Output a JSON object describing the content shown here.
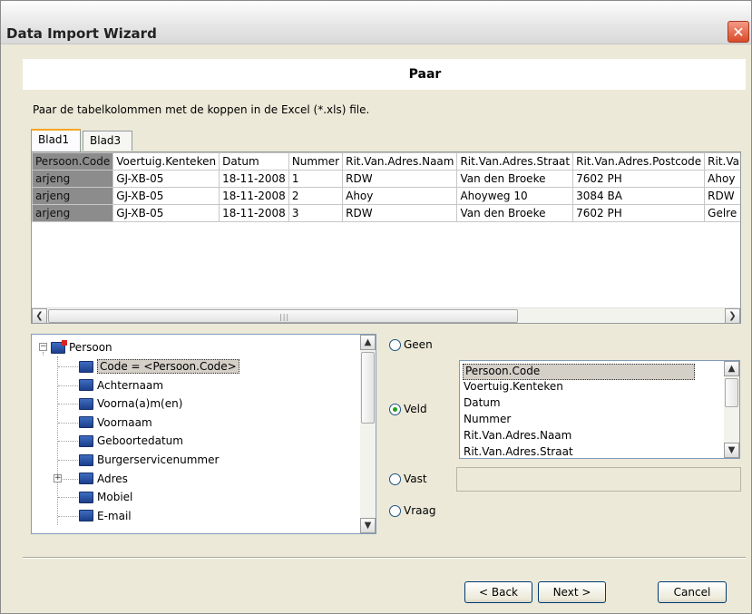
{
  "window": {
    "title": "Data Import Wizard",
    "close_glyph": "✕"
  },
  "header": {
    "title": "Paar"
  },
  "instruction": "Paar de tabelkolommen met de koppen in de Excel (*.xls) file.",
  "tabs": [
    {
      "label": "Blad1",
      "active": true
    },
    {
      "label": "Blad3",
      "active": false
    }
  ],
  "grid": {
    "columns": [
      "Persoon.Code",
      "Voertuig.Kenteken",
      "Datum",
      "Nummer",
      "Rit.Van.Adres.Naam",
      "Rit.Van.Adres.Straat",
      "Rit.Van.Adres.Postcode",
      "Rit.Van.Adres.Plaats"
    ],
    "rows": [
      [
        "arjeng",
        "GJ-XB-05",
        "18-11-2008",
        "1",
        "RDW",
        "Van den Broeke",
        "7602 PH",
        "Ahoy"
      ],
      [
        "arjeng",
        "GJ-XB-05",
        "18-11-2008",
        "2",
        "Ahoy",
        "Ahoyweg 10",
        "3084 BA",
        "RDW"
      ],
      [
        "arjeng",
        "GJ-XB-05",
        "18-11-2008",
        "3",
        "RDW",
        "Van den Broeke",
        "7602 PH",
        "Gelre"
      ]
    ]
  },
  "tree": {
    "root": "Persoon",
    "items": [
      {
        "label": "Code = <Persoon.Code>",
        "selected": true,
        "expandable": false
      },
      {
        "label": "Achternaam",
        "expandable": false
      },
      {
        "label": "Voorna(a)m(en)",
        "expandable": false
      },
      {
        "label": "Voornaam",
        "expandable": false
      },
      {
        "label": "Geboortedatum",
        "expandable": false
      },
      {
        "label": "Burgerservicenummer",
        "expandable": false
      },
      {
        "label": "Adres",
        "expandable": true
      },
      {
        "label": "Mobiel",
        "expandable": false
      },
      {
        "label": "E-mail",
        "expandable": false
      }
    ]
  },
  "options": {
    "geen": "Geen",
    "veld": "Veld",
    "vast": "Vast",
    "vraag": "Vraag",
    "selected": "veld"
  },
  "field_list": {
    "items": [
      "Persoon.Code",
      "Voertuig.Kenteken",
      "Datum",
      "Nummer",
      "Rit.Van.Adres.Naam",
      "Rit.Van.Adres.Straat"
    ],
    "selected_index": 0
  },
  "vast_value": "",
  "buttons": {
    "back": "< Back",
    "next": "Next >",
    "cancel": "Cancel"
  }
}
